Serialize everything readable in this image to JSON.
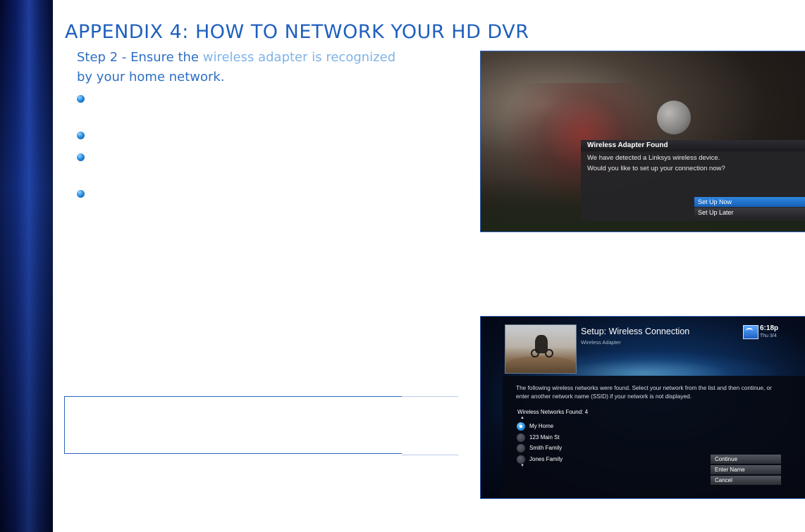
{
  "page": {
    "title": "APPENDIX 4: HOW TO NETWORK YOUR HD DVR",
    "step": {
      "part1": "Step 2 - Ensure the ",
      "part2": "wireless adapter is recognized",
      "part3": "by your home network."
    }
  },
  "screen1": {
    "dialog_title": "Wireless Adapter Found",
    "line1": "We have detected a Linksys wireless device.",
    "line2": "Would you like to set up your connection now?",
    "options": [
      "Set Up Now",
      "Set Up Later"
    ]
  },
  "screen2": {
    "title": "Setup: Wireless Connection",
    "subtitle": "Wireless Adapter",
    "time": "6:18p",
    "date": "Thu 3/4",
    "description": "The following wireless networks were found. Select your network from the list and then continue, or enter another network name (SSID) if your network is not displayed.",
    "found_label": "Wireless Networks Found: 4",
    "networks": [
      "My Home",
      "123 Main St",
      "Smith Family",
      "Jones Family"
    ],
    "buttons": [
      "Continue",
      "Enter Name",
      "Cancel"
    ]
  },
  "colors": {
    "accent": "#1f5fbf",
    "highlight": "#2e87de"
  }
}
